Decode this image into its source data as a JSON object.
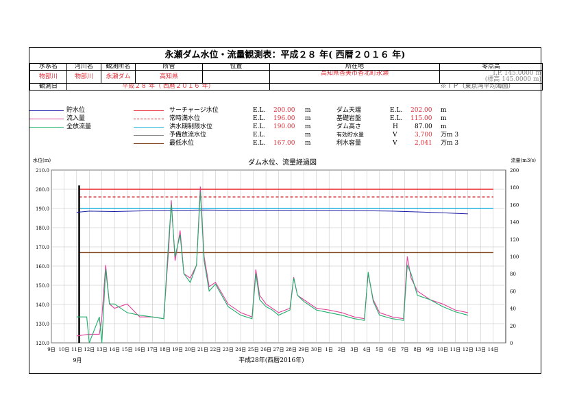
{
  "title": "永瀬ダム水位・流量観測表：平成２８ 年( 西暦２０１６ 年)",
  "header": {
    "labels": [
      "水系名",
      "河川名",
      "観測所名",
      "所管",
      "位置",
      "所在地",
      "零点高"
    ],
    "values": [
      "物部川",
      "物部川",
      "永瀬ダム",
      "高知県",
      "",
      "高知県香美市香北町永瀬",
      ""
    ],
    "zero_height": [
      "T.P. 145.0000 m",
      "(標高 145.0000 m)"
    ],
    "period_label": "観測日",
    "period_value": "平成２８ 年（ 西暦２０１６ 年）",
    "datum_note": "※ＴＰ（東京湾平均海面）"
  },
  "legend": {
    "series": [
      {
        "label": "貯水位",
        "color": "#1a1aa6"
      },
      {
        "label": "流入量",
        "color": "#e0409a"
      },
      {
        "label": "全放流量",
        "color": "#1fae6a"
      }
    ],
    "levels": [
      {
        "label": "サーチャージ水位",
        "unit": "E.L.",
        "value": "200.00",
        "m": "m",
        "color": "#e8202a",
        "dash": false
      },
      {
        "label": "常時満水位",
        "unit": "E.L.",
        "value": "196.00",
        "m": "m",
        "color": "#d0101a",
        "dash": true
      },
      {
        "label": "洪水期制限水位",
        "unit": "E.L.",
        "value": "190.00",
        "m": "m",
        "color": "#22b3e0",
        "dash": false
      },
      {
        "label": "予備放流水位",
        "unit": "E.L.",
        "value": "",
        "m": "m",
        "color": "#888888",
        "dash": false
      },
      {
        "label": "最低水位",
        "unit": "E.L.",
        "value": "167.00",
        "m": "m",
        "color": "#7a3a12",
        "dash": false
      }
    ],
    "dam_specs": [
      {
        "label": "ダム天端",
        "unit": "E.L.",
        "value": "202.00",
        "m": "m"
      },
      {
        "label": "基礎岩盤",
        "unit": "E.L.",
        "value": "115.00",
        "m": "m"
      },
      {
        "label": "ダム高さ",
        "unit": "H",
        "value": "87.00",
        "m": "m"
      },
      {
        "label": "有効貯水量",
        "unit": "V",
        "value": "3,700",
        "m": "万m 3"
      },
      {
        "label": "利水容量",
        "unit": "V",
        "value": "2,041",
        "m": "万m 3"
      }
    ]
  },
  "chart_data": {
    "type": "line",
    "title": "ダム水位、流量経過図",
    "ylabel": "水位(m)",
    "y2label": "流量(m3/s)",
    "ylim": [
      120,
      210
    ],
    "y2lim": [
      0,
      200
    ],
    "yticks": [
      "120.0",
      "130.0",
      "140.0",
      "150.0",
      "160.0",
      "170.0",
      "180.0",
      "190.0",
      "200.0",
      "210.0"
    ],
    "y2ticks": [
      "0",
      "20",
      "40",
      "60",
      "80",
      "100",
      "120",
      "140",
      "160",
      "180",
      "200"
    ],
    "x_ticks": [
      "9日",
      "10日",
      "11日",
      "12日",
      "13日",
      "14日",
      "15日",
      "16日",
      "17日",
      "18日",
      "19日",
      "20日",
      "21日",
      "22日",
      "23日",
      "24日",
      "25日",
      "26日",
      "27日",
      "28日",
      "29日",
      "30日",
      "1日",
      "2日",
      "3日",
      "4日",
      "5日",
      "6日",
      "7日",
      "8日",
      "9日",
      "10日",
      "11日",
      "12日",
      "13日",
      "14日"
    ],
    "xlabel": "平成28年(西暦2016年)",
    "month_labels": [
      "9月"
    ],
    "xlim": [
      9,
      14
    ],
    "series": [
      {
        "name": "貯水位",
        "axis": "left",
        "color": "#1a1aa6",
        "x": [
          11.0,
          12.0,
          14.0,
          18.0,
          19.0,
          21.0,
          24.0,
          27.0,
          30.0,
          33.0,
          36.0,
          39.0,
          42.0
        ],
        "values": [
          188.0,
          188.6,
          188.4,
          189.0,
          189.0,
          189.2,
          189.0,
          189.1,
          189.0,
          188.9,
          188.6,
          188.0,
          187.2
        ]
      },
      {
        "name": "流入量",
        "axis": "right",
        "color": "#e0409a",
        "x": [
          11.0,
          12.0,
          12.8,
          13.0,
          13.3,
          13.6,
          14.0,
          15.0,
          16.0,
          17.0,
          17.9,
          18.3,
          18.5,
          18.8,
          19.2,
          19.5,
          20.0,
          20.5,
          20.8,
          21.1,
          21.5,
          22.0,
          23.0,
          24.0,
          24.9,
          25.2,
          25.5,
          26.0,
          26.5,
          27.0,
          27.9,
          28.2,
          28.5,
          29.0,
          30.0,
          31.0,
          32.0,
          33.0,
          33.8,
          34.1,
          34.5,
          35.0,
          36.0,
          36.9,
          37.2,
          37.5,
          38.0,
          39.0,
          40.0,
          41.0,
          42.0
        ],
        "values": [
          8,
          10,
          10,
          30,
          90,
          45,
          40,
          45,
          30,
          30,
          28,
          110,
          165,
          95,
          130,
          80,
          75,
          90,
          181,
          100,
          65,
          70,
          45,
          35,
          30,
          85,
          55,
          45,
          40,
          35,
          40,
          76,
          55,
          50,
          40,
          38,
          35,
          30,
          28,
          80,
          50,
          35,
          30,
          28,
          100,
          75,
          60,
          50,
          45,
          38,
          35
        ]
      },
      {
        "name": "全放流量",
        "axis": "right",
        "color": "#1fae6a",
        "x": [
          11.0,
          11.8,
          12.0,
          12.8,
          13.0,
          13.3,
          13.6,
          14.0,
          15.0,
          16.0,
          17.0,
          17.9,
          18.3,
          18.5,
          18.8,
          19.2,
          19.5,
          20.0,
          20.5,
          20.8,
          21.1,
          21.5,
          22.0,
          23.0,
          24.0,
          24.9,
          25.2,
          25.5,
          26.0,
          26.5,
          27.0,
          27.9,
          28.2,
          28.5,
          29.0,
          30.0,
          31.0,
          32.0,
          33.0,
          33.8,
          34.1,
          34.5,
          35.0,
          36.0,
          36.9,
          37.2,
          37.5,
          38.0,
          39.0,
          40.0,
          41.0,
          42.0
        ],
        "values": [
          30,
          30,
          0,
          30,
          0,
          85,
          45,
          45,
          35,
          32,
          30,
          28,
          120,
          160,
          100,
          125,
          80,
          70,
          90,
          175,
          95,
          60,
          68,
          42,
          32,
          28,
          80,
          50,
          42,
          38,
          32,
          38,
          75,
          55,
          48,
          38,
          35,
          32,
          28,
          26,
          82,
          48,
          32,
          28,
          26,
          90,
          80,
          55,
          50,
          42,
          36,
          32
        ]
      }
    ],
    "levels_elevation": [
      200,
      196,
      190,
      167
    ],
    "grid": true
  }
}
